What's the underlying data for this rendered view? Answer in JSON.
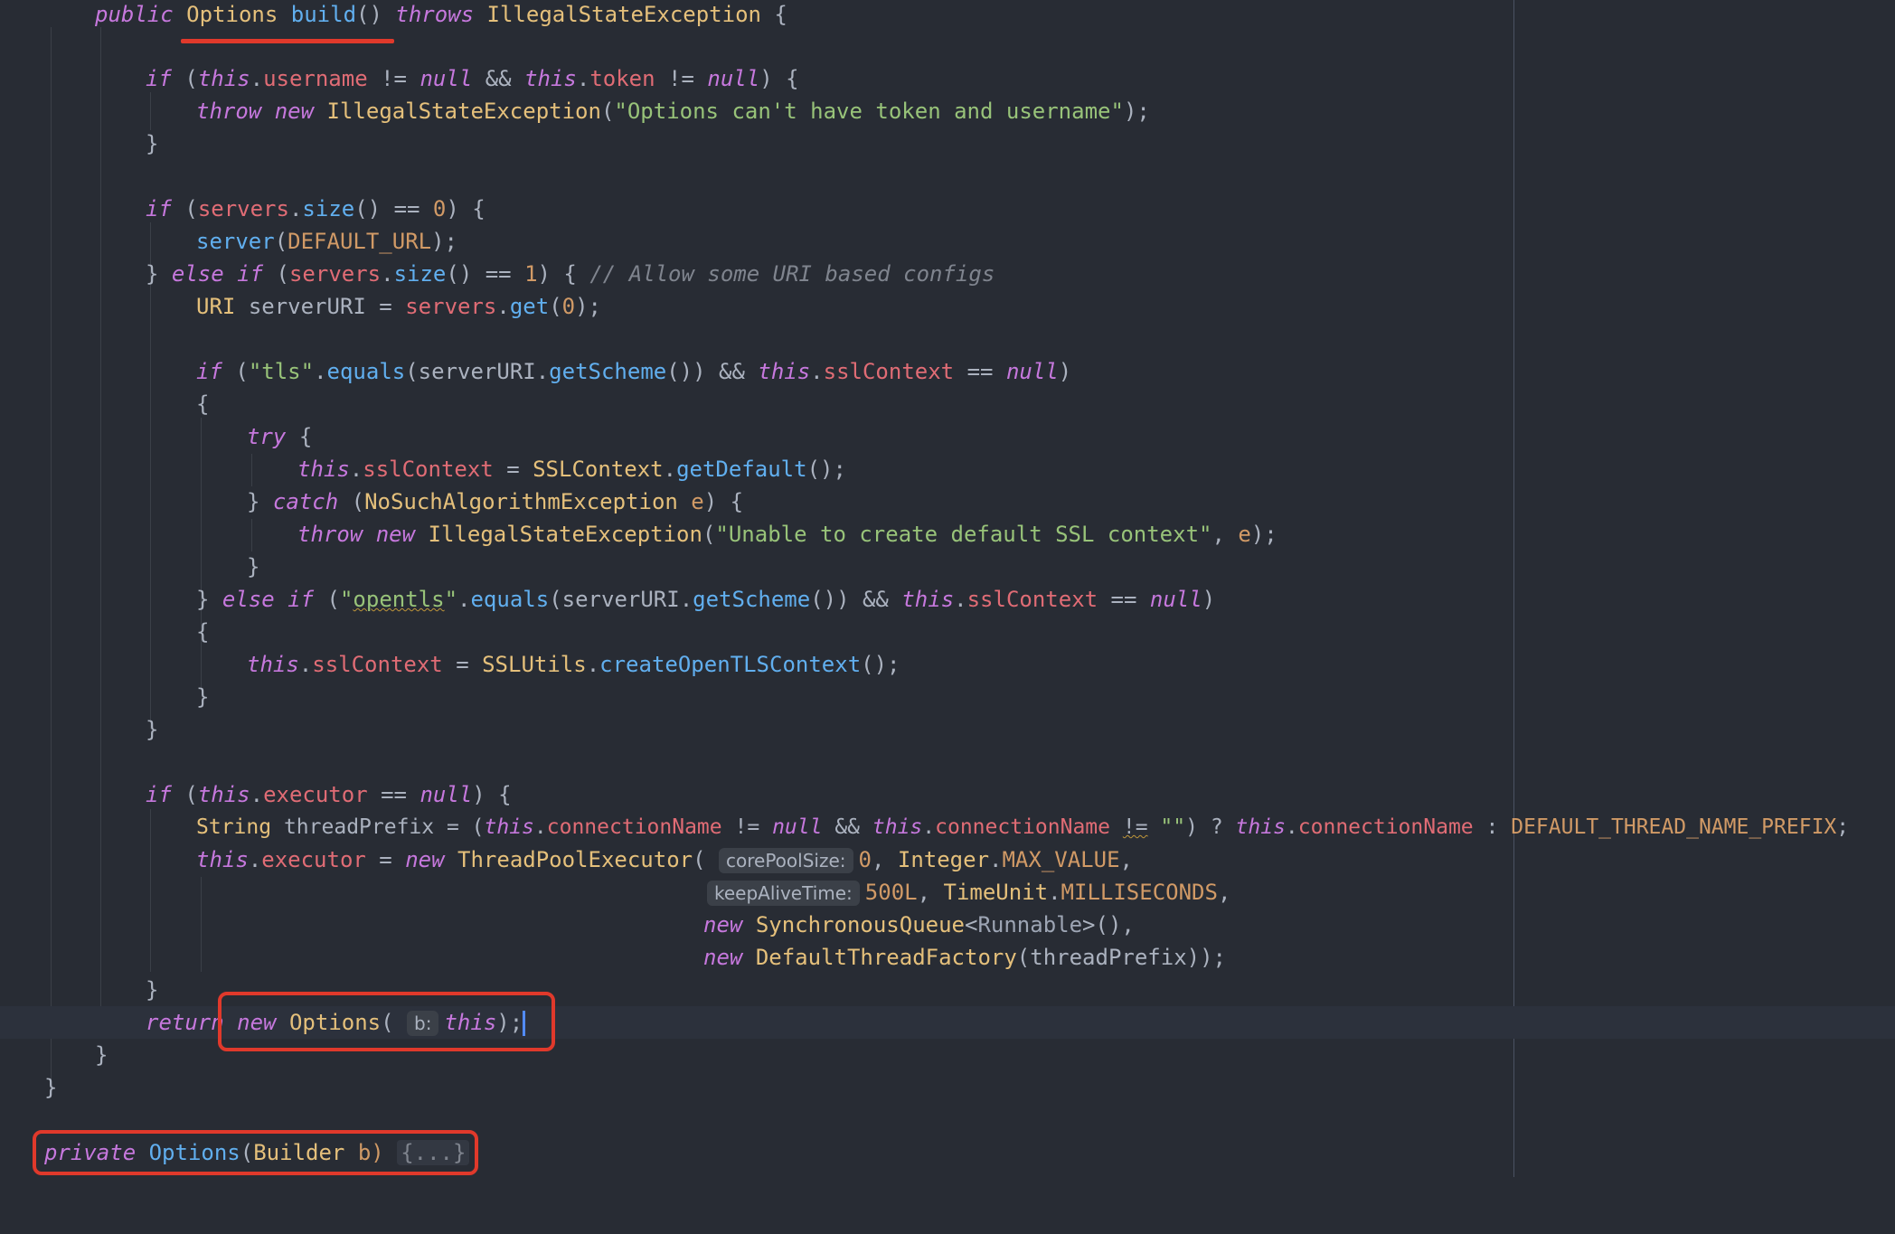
{
  "code": {
    "l01": {
      "kw": "public",
      "cls": "Options",
      "fn": "build",
      "p": "()",
      "kw2": "throws",
      "cls2": "IllegalStateException",
      "br": "{"
    },
    "l02": {
      "kw": "if",
      "this1": "this",
      "f1": "username",
      "op": "!=",
      "nul": "null",
      "and": "&&",
      "this2": "this",
      "f2": "token",
      "op2": "!=",
      "nul2": "null",
      "br": ") {"
    },
    "l03": {
      "kw": "throw",
      "kw2": "new",
      "cls": "IllegalStateException",
      "str": "\"Options can't have token and username\"",
      "end": ");"
    },
    "l04": "}",
    "l05": {
      "kw": "if",
      "f": "servers",
      "fn": "size",
      "op": "() ==",
      "num": "0",
      "br": ") {"
    },
    "l06": {
      "fn": "server",
      "cst": "DEFAULT_URL",
      "end": ");"
    },
    "l07": {
      "br": "}",
      "kw": "else if",
      "f": "servers",
      "fn": "size",
      "op": "() ==",
      "num": "1",
      "br2": ") {",
      "com": "// Allow some URI based configs"
    },
    "l08": {
      "cls": "URI",
      "var": "serverURI =",
      "f": "servers",
      "fn": "get",
      "num": "0",
      "end": ");"
    },
    "l09": {
      "kw": "if",
      "str": "\"tls\"",
      "fn": "equals",
      "var": "serverURI",
      "fn2": "getScheme",
      "and": "()) &&",
      "this": "this",
      "f": "sslContext",
      "op": "==",
      "nul": "null",
      "end": ")"
    },
    "l10": "{",
    "l11": {
      "kw": "try",
      "br": "{"
    },
    "l12": {
      "this": "this",
      "f": "sslContext",
      "op": "=",
      "cls": "SSLContext",
      "fn": "getDefault",
      "end": "();"
    },
    "l13": {
      "br": "}",
      "kw": "catch",
      "cls": "NoSuchAlgorithmException",
      "par": "e",
      "br2": ") {"
    },
    "l14": {
      "kw": "throw",
      "kw2": "new",
      "cls": "IllegalStateException",
      "str": "\"Unable to create default SSL context\"",
      "par": "e",
      "end": ");"
    },
    "l15": "}",
    "l16": {
      "br": "}",
      "kw": "else if",
      "str_q": "\"",
      "str_w": "opentls",
      "fn": "equals",
      "var": "serverURI",
      "fn2": "getScheme",
      "and": "()) &&",
      "this": "this",
      "f": "sslContext",
      "op": "==",
      "nul": "null",
      "end": ")"
    },
    "l17": "{",
    "l18": {
      "this": "this",
      "f": "sslContext",
      "op": "=",
      "cls": "SSLUtils",
      "fn": "createOpenTLSContext",
      "end": "();"
    },
    "l19": "}",
    "l20": "}",
    "l21": {
      "kw": "if",
      "this": "this",
      "f": "executor",
      "op": "==",
      "nul": "null",
      "br": ") {"
    },
    "l22": {
      "cls": "String",
      "var": "threadPrefix = (",
      "this": "this",
      "f": "connectionName",
      "op": "!=",
      "nul": "null",
      "and": "&&",
      "this2": "this",
      "f2": "connectionName",
      "neq": "!=",
      "emp": "\"\"",
      "q": ") ?",
      "this3": "this",
      "f3": "connectionName",
      "colon": ":",
      "cst": "DEFAULT_THREAD_NAME_PREFIX",
      "end": ";"
    },
    "l23": {
      "this": "this",
      "f": "executor",
      "op": "=",
      "kw": "new",
      "cls": "ThreadPoolExecutor",
      "hint": "corePoolSize:",
      "num": "0",
      "cls2": "Integer",
      "cst": "MAX_VALUE",
      "end": ","
    },
    "l24": {
      "hint": "keepAliveTime:",
      "num": "500L",
      "cls": "TimeUnit",
      "cst": "MILLISECONDS",
      "end": ","
    },
    "l25": {
      "kw": "new",
      "cls": "SynchronousQueue",
      "gen": "Runnable",
      "end": ">(),"
    },
    "l26": {
      "kw": "new",
      "cls": "DefaultThreadFactory",
      "var": "(threadPrefix));"
    },
    "l27": "}",
    "l28": {
      "kw": "return",
      "kw2": "new",
      "cls": "Options",
      "hint": "b:",
      "this": "this",
      "end": ");"
    },
    "l29": "}",
    "l30": "}",
    "l31": {
      "kw": "private",
      "fn": "Options",
      "cls": "Builder",
      "par": "b)",
      "fold": "{...}"
    }
  }
}
